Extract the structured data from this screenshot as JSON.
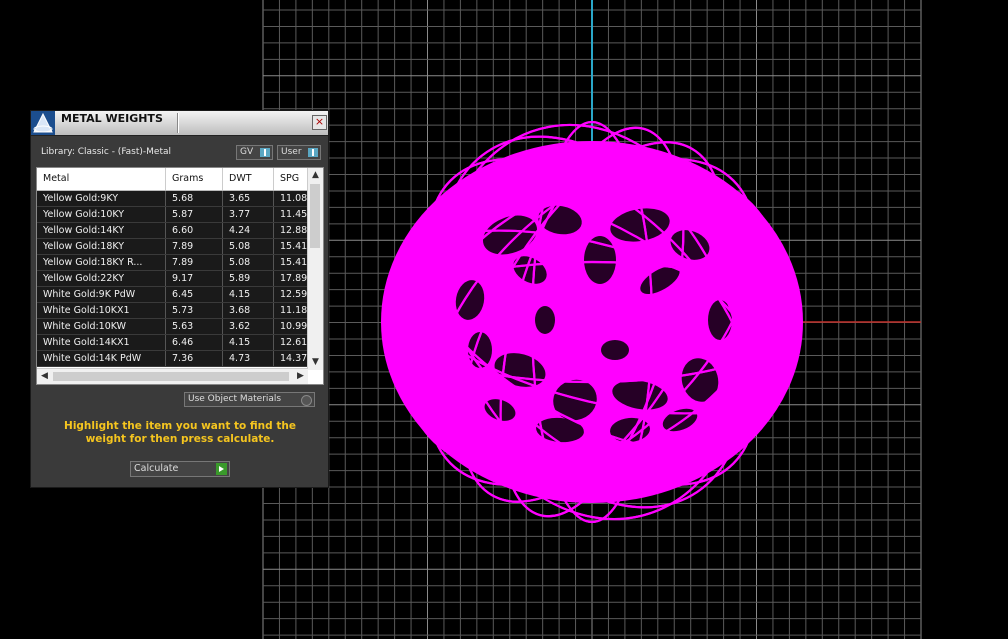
{
  "panel": {
    "title": "METAL WEIGHTS",
    "close_label": "×",
    "library_label": "Library: Classic - (Fast)-Metal",
    "gv_label": "GV",
    "user_label": "User",
    "use_object_label": "Use Object Materials",
    "instructions": "Highlight the item you want to find the weight for then press calculate.",
    "calculate_label": "Calculate"
  },
  "table": {
    "columns": [
      "Metal",
      "Grams",
      "DWT",
      "SPG"
    ],
    "rows": [
      [
        "Yellow Gold:9KY",
        "5.68",
        "3.65",
        "11.08"
      ],
      [
        "Yellow Gold:10KY",
        "5.87",
        "3.77",
        "11.45"
      ],
      [
        "Yellow Gold:14KY",
        "6.60",
        "4.24",
        "12.88"
      ],
      [
        "Yellow Gold:18KY",
        "7.89",
        "5.08",
        "15.41"
      ],
      [
        "Yellow Gold:18KY R...",
        "7.89",
        "5.08",
        "15.41"
      ],
      [
        "Yellow Gold:22KY",
        "9.17",
        "5.89",
        "17.89"
      ],
      [
        "White Gold:9K PdW",
        "6.45",
        "4.15",
        "12.59"
      ],
      [
        "White Gold:10KX1",
        "5.73",
        "3.68",
        "11.18"
      ],
      [
        "White Gold:10KW",
        "5.63",
        "3.62",
        "10.99"
      ],
      [
        "White Gold:14KX1",
        "6.46",
        "4.15",
        "12.61"
      ],
      [
        "White Gold:14K PdW",
        "7.36",
        "4.73",
        "14.37"
      ]
    ]
  },
  "viewport": {
    "object_color": "#ff00ff",
    "grid_color": "#5a5a5a",
    "axis_y_color": "#2aa7c9",
    "axis_x_color": "#c0302a"
  },
  "icons": {
    "panel_logo": "pyramid-logo-icon",
    "close": "close-icon",
    "scroll_up": "chevron-up-icon",
    "scroll_down": "chevron-down-icon",
    "scroll_left": "chevron-left-icon",
    "scroll_right": "chevron-right-icon",
    "play": "play-icon"
  }
}
